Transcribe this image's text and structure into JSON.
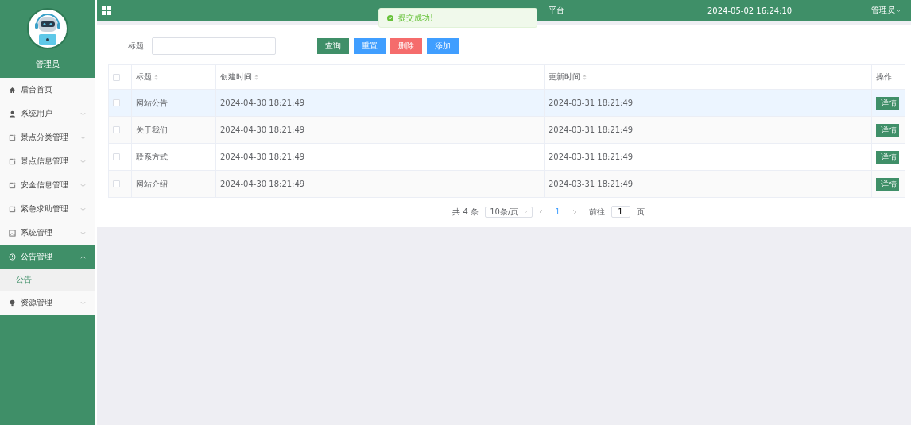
{
  "header": {
    "title": "平台",
    "datetime": "2024-05-02 16:24:10",
    "user": "管理员"
  },
  "toast": {
    "message": "提交成功!"
  },
  "sidebar": {
    "user": "管理员",
    "items": [
      {
        "label": "后台首页",
        "kind": "link",
        "selected": false
      },
      {
        "label": "系统用户",
        "kind": "menu",
        "expanded": false,
        "selected": false
      },
      {
        "label": "景点分类管理",
        "kind": "menu",
        "expanded": false,
        "selected": false
      },
      {
        "label": "景点信息管理",
        "kind": "menu",
        "expanded": false,
        "selected": false
      },
      {
        "label": "安全信息管理",
        "kind": "menu",
        "expanded": false,
        "selected": false
      },
      {
        "label": "紧急求助管理",
        "kind": "menu",
        "expanded": false,
        "selected": false
      },
      {
        "label": "系统管理",
        "kind": "menu",
        "expanded": false,
        "selected": false
      },
      {
        "label": "公告管理",
        "kind": "menu",
        "expanded": true,
        "selected": true,
        "children": [
          {
            "label": "公告",
            "selected": true
          }
        ]
      },
      {
        "label": "资源管理",
        "kind": "menu",
        "expanded": false,
        "selected": false
      }
    ]
  },
  "search": {
    "label": "标题"
  },
  "buttons": [
    {
      "label": "查询",
      "kind": "primary"
    },
    {
      "label": "重置",
      "kind": "info"
    },
    {
      "label": "删除",
      "kind": "danger"
    },
    {
      "label": "添加",
      "kind": "info"
    }
  ],
  "table": {
    "all_checked": false,
    "columns": [
      {
        "label": "标题",
        "sortable": true
      },
      {
        "label": "创建时间",
        "sortable": true
      },
      {
        "label": "更新时间",
        "sortable": true
      },
      {
        "label": "操作",
        "sortable": false
      }
    ],
    "rows": [
      {
        "title": "网站公告",
        "created": "2024-04-30 18:21:49",
        "updated": "2024-03-31 18:21:49",
        "action": "详情",
        "checked": false,
        "highlighted": true
      },
      {
        "title": "关于我们",
        "created": "2024-04-30 18:21:49",
        "updated": "2024-03-31 18:21:49",
        "action": "详情",
        "checked": false,
        "highlighted": false
      },
      {
        "title": "联系方式",
        "created": "2024-04-30 18:21:49",
        "updated": "2024-03-31 18:21:49",
        "action": "详情",
        "checked": false,
        "highlighted": false
      },
      {
        "title": "网站介绍",
        "created": "2024-04-30 18:21:49",
        "updated": "2024-03-31 18:21:49",
        "action": "详情",
        "checked": false,
        "highlighted": false
      }
    ]
  },
  "pagination": {
    "total": "共 4 条",
    "page_size": "10条/页",
    "pages": [
      {
        "label": "1",
        "selected": true
      }
    ],
    "goto_label": "前往",
    "goto_value": "1",
    "page_unit": "页"
  }
}
